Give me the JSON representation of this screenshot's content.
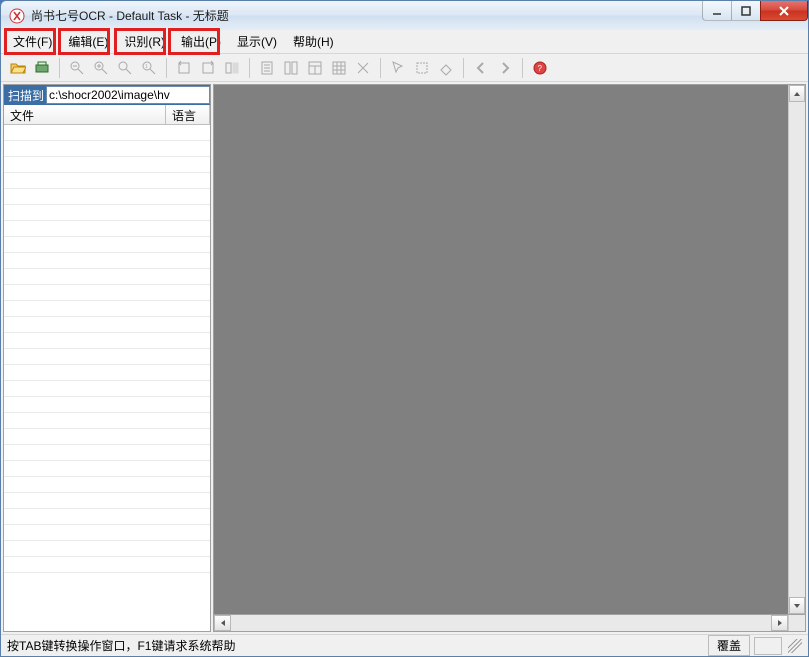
{
  "window": {
    "title": "尚书七号OCR - Default Task - 无标题"
  },
  "menus": {
    "file": "文件(F)",
    "edit": "编辑(E)",
    "recognize": "识别(R)",
    "output": "输出(P)",
    "view": "显示(V)",
    "help": "帮助(H)"
  },
  "left": {
    "scan_label": "扫描到",
    "scan_path": "c:\\shocr2002\\image\\hv",
    "col_file": "文件",
    "col_lang": "语言"
  },
  "status": {
    "hint": "按TAB键转换操作窗口，F1键请求系统帮助",
    "mode": "覆盖"
  }
}
